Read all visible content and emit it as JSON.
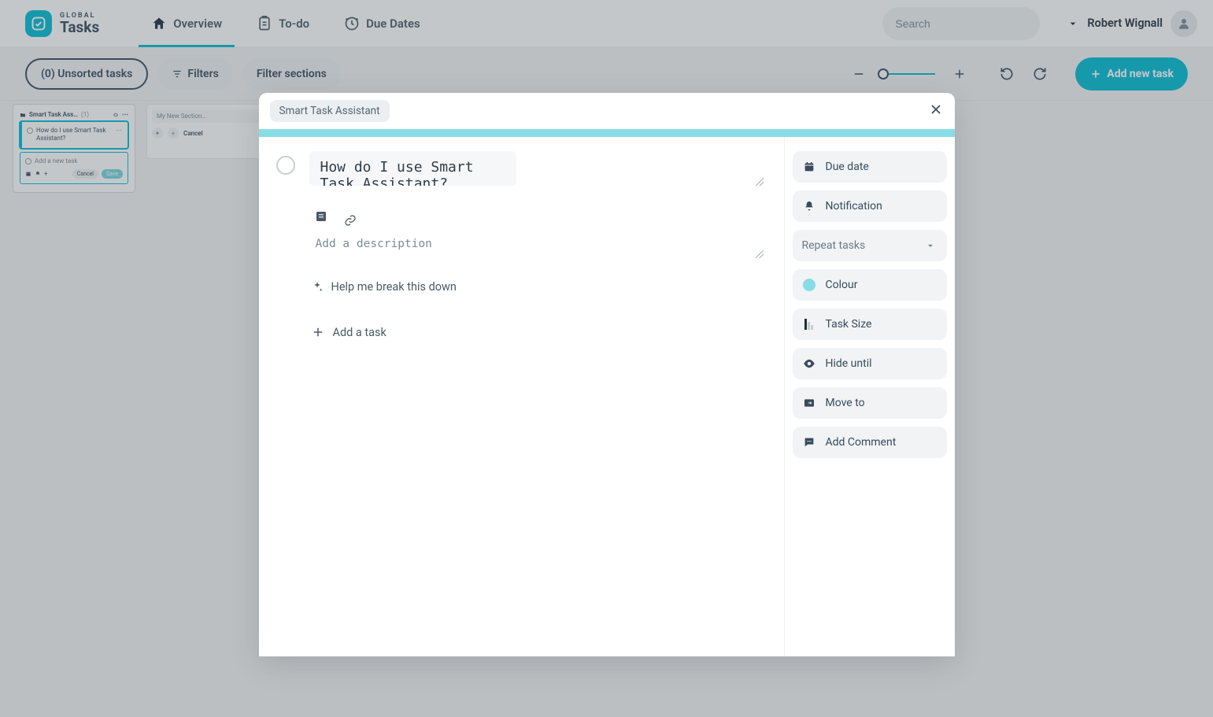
{
  "app": {
    "brand_small": "GLOBAL",
    "brand_big": "Tasks"
  },
  "nav": {
    "overview": "Overview",
    "todo": "To-do",
    "duedates": "Due Dates"
  },
  "search": {
    "placeholder": "Search"
  },
  "user": {
    "name": "Robert Wignall"
  },
  "toolbar": {
    "unsorted": "(0) Unsorted tasks",
    "filters": "Filters",
    "filter_sections": "Filter sections",
    "add_task": "Add new task"
  },
  "mini_card": {
    "section_title": "Smart Task Ass…",
    "section_count": "(1)",
    "task1": "How do I use Smart Task Assistant?",
    "add_placeholder": "Add a new task",
    "cancel": "Cancel",
    "save": "Save"
  },
  "bg_section": {
    "title_placeholder": "My New Section…",
    "cancel": "Cancel"
  },
  "modal": {
    "breadcrumb": "Smart Task Assistant",
    "task_title": "How do I use Smart Task Assistant?",
    "desc_placeholder": "Add a description",
    "assist": "Help me break this down",
    "add_subtask": "Add a task",
    "props": {
      "due_date": "Due date",
      "notification": "Notification",
      "repeat": "Repeat tasks",
      "colour": "Colour",
      "task_size": "Task Size",
      "hide_until": "Hide until",
      "move_to": "Move to",
      "add_comment": "Add Comment"
    }
  }
}
